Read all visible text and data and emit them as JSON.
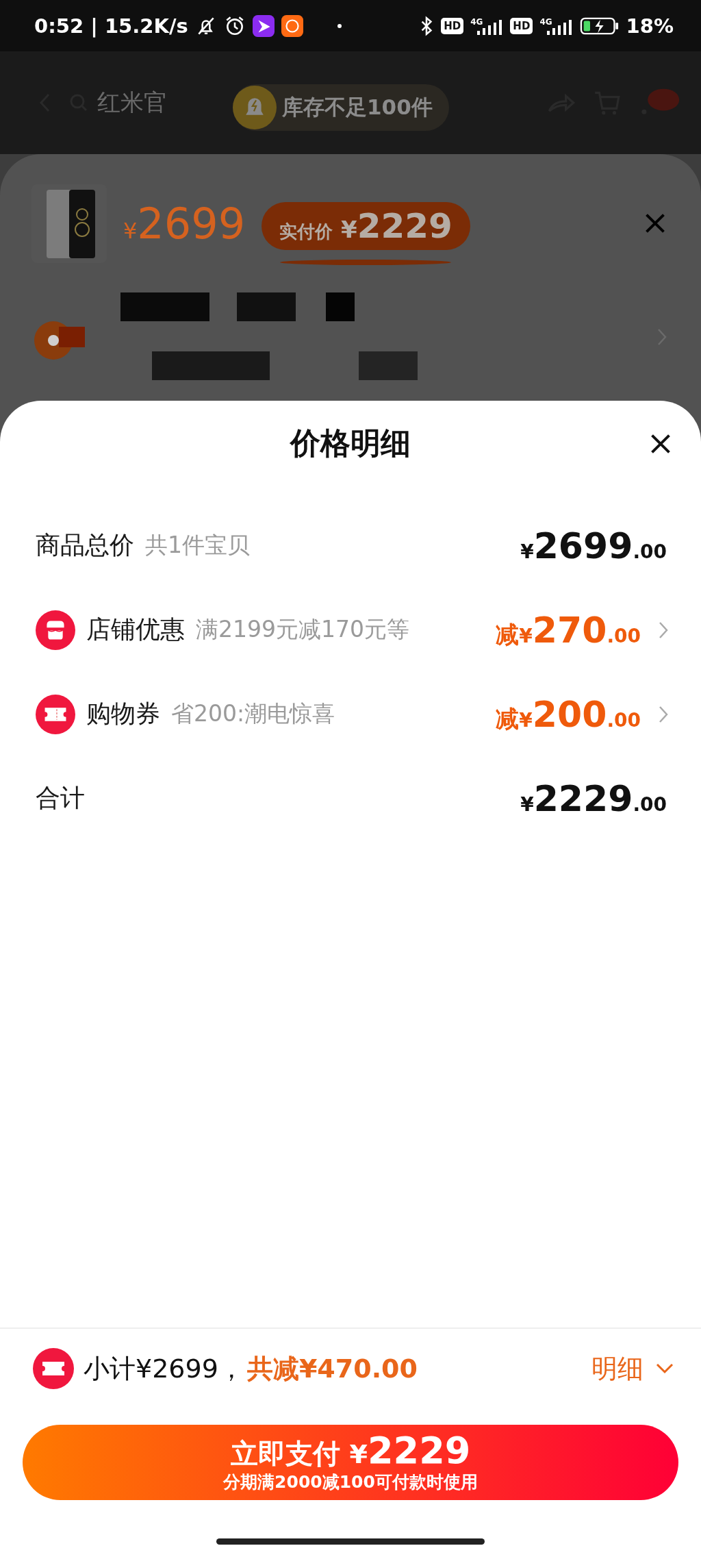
{
  "status_bar": {
    "clock": "0:52 | 15.2K/s",
    "sims": [
      {
        "hd": "HD",
        "net": "4G"
      },
      {
        "hd": "HD",
        "net": "4G"
      }
    ],
    "battery": "18%"
  },
  "nav": {
    "search_text": "红米官",
    "toast": "库存不足100件"
  },
  "product": {
    "currency": "¥",
    "price": "2699",
    "badge_label": "实付价",
    "badge_currency": "¥",
    "badge_price": "2229"
  },
  "sheet": {
    "title": "价格明细",
    "rows": [
      {
        "kind": "plain",
        "label": "商品总价",
        "note": "共1件宝贝",
        "currency": "¥",
        "amount": "2699",
        "decimals": ".00"
      },
      {
        "kind": "store",
        "label": "店铺优惠",
        "note": "满2199元减170元等",
        "prefix": "减",
        "currency": "¥",
        "amount": "270",
        "decimals": ".00"
      },
      {
        "kind": "coupon",
        "label": "购物券",
        "note": "省200:潮电惊喜",
        "prefix": "减",
        "currency": "¥",
        "amount": "200",
        "decimals": ".00"
      },
      {
        "kind": "plain",
        "label": "合计",
        "currency": "¥",
        "amount": "2229",
        "decimals": ".00"
      }
    ]
  },
  "summary": {
    "subtotal": "小计¥2699，",
    "saving": "共减¥470.00",
    "details": "明细"
  },
  "pay_button": {
    "label": "立即支付",
    "currency": "¥",
    "amount": "2229",
    "note": "分期满2000减100可付款时使用"
  }
}
